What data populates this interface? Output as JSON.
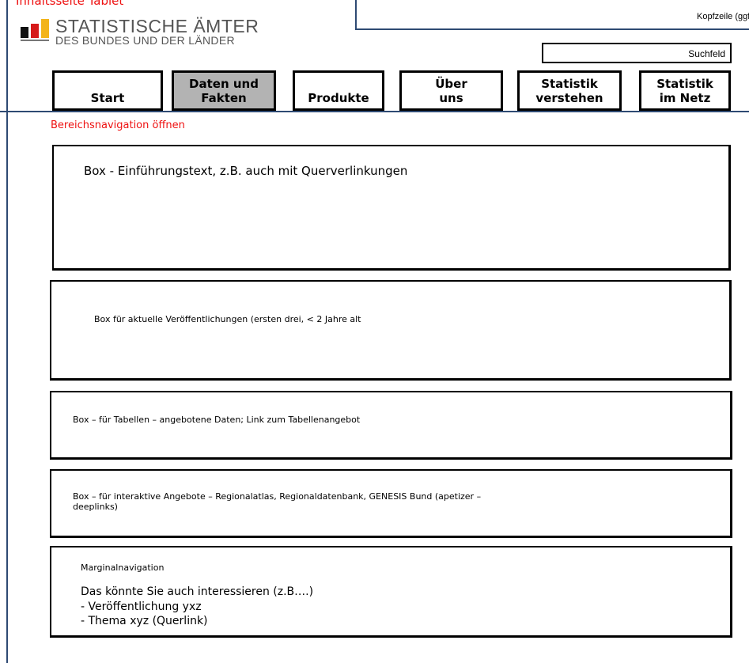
{
  "page_label": "Inhaltsseite Tablet",
  "header": {
    "kopfzeile": "Kopfzeile (ggf.)",
    "logo_title": "STATISTISCHE ÄMTER",
    "logo_subtitle": "DES BUNDES UND DER LÄNDER",
    "search_label": "Suchfeld"
  },
  "nav": {
    "items": [
      {
        "label": "Start",
        "active": false
      },
      {
        "label": "Daten und\nFakten",
        "active": true
      },
      {
        "label": "Produkte",
        "active": false
      },
      {
        "label": "Über\nuns",
        "active": false
      },
      {
        "label": "Statistik\nverstehen",
        "active": false
      },
      {
        "label": "Statistik\nim Netz",
        "active": false
      }
    ]
  },
  "bereichsnavigation": "Bereichsnavigation öffnen",
  "boxes": {
    "intro": "Box - Einführungstext, z.B. auch mit Querverlinkungen",
    "publications": "Box für aktuelle Veröffentlichungen (ersten drei, < 2 Jahre alt",
    "tables": "Box – für Tabellen – angebotene Daten; Link zum Tabellenangebot",
    "interactive": "Box – für interaktive Angebote – Regionalatlas, Regionaldatenbank, GENESIS Bund (apetizer – deeplinks)",
    "marginal": {
      "label": "Marginalnavigation",
      "heading": "Das könnte Sie auch interessieren (z.B….)",
      "items": [
        "-  Veröffentlichung yxz",
        "-  Thema xyz (Querlink)"
      ]
    }
  },
  "colors": {
    "frame_line": "#2e4a73",
    "accent_red": "#ee1111",
    "active_nav": "#b3b3b3"
  }
}
